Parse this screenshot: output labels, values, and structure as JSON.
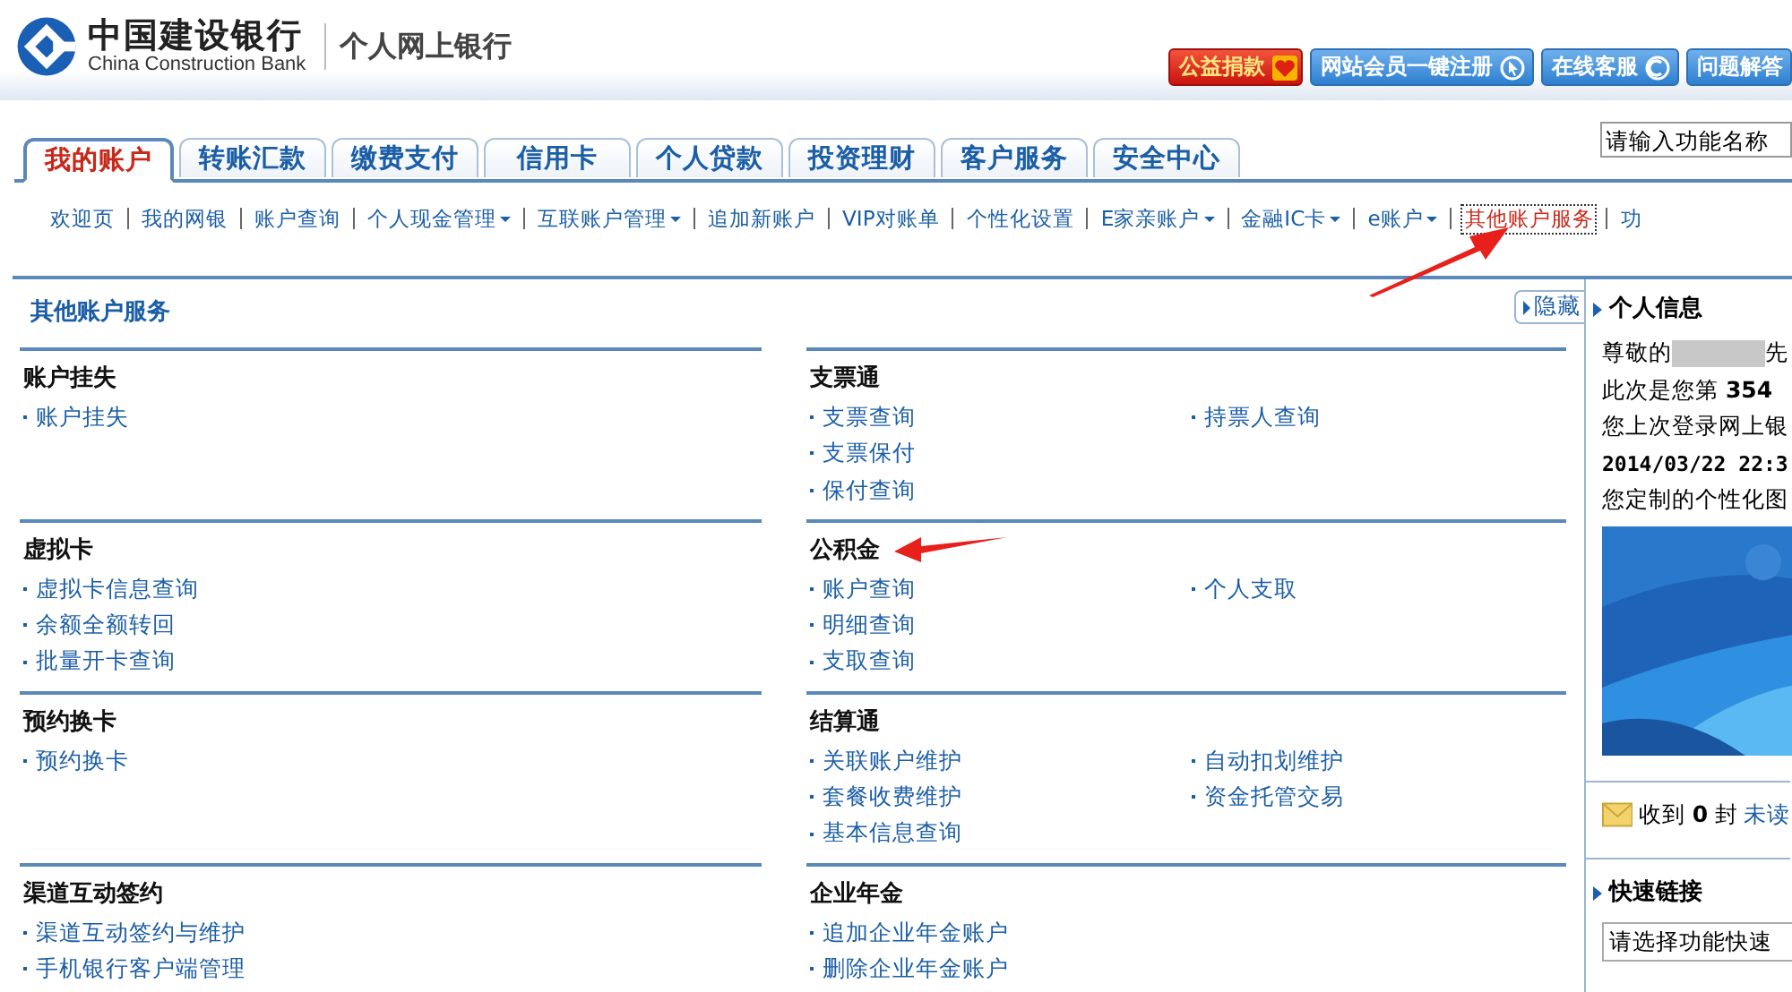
{
  "header": {
    "bank_name": "中国建设银行",
    "bank_name_en": "China Construction Bank",
    "product": "个人网上银行",
    "buttons": [
      {
        "label": "公益捐款",
        "kind": "donate"
      },
      {
        "label": "网站会员一键注册",
        "kind": "register"
      },
      {
        "label": "在线客服",
        "kind": "service"
      },
      {
        "label": "问题解答",
        "kind": "plain"
      }
    ]
  },
  "search": {
    "placeholder": "请输入功能名称"
  },
  "tabs": [
    {
      "label": "我的账户",
      "selected": true
    },
    {
      "label": "转账汇款",
      "selected": false
    },
    {
      "label": "缴费支付",
      "selected": false
    },
    {
      "label": "信用卡",
      "selected": false
    },
    {
      "label": "个人贷款",
      "selected": false
    },
    {
      "label": "投资理财",
      "selected": false
    },
    {
      "label": "客户服务",
      "selected": false
    },
    {
      "label": "安全中心",
      "selected": false
    }
  ],
  "subnav": [
    {
      "label": "欢迎页",
      "has_menu": false,
      "selected": false,
      "arrow": false
    },
    {
      "label": "我的网银",
      "has_menu": false,
      "selected": false,
      "arrow": false
    },
    {
      "label": "账户查询",
      "has_menu": false,
      "selected": false,
      "arrow": false
    },
    {
      "label": "个人现金管理",
      "has_menu": true,
      "selected": false,
      "arrow": false
    },
    {
      "label": "互联账户管理",
      "has_menu": true,
      "selected": false,
      "arrow": false
    },
    {
      "label": "追加新账户",
      "has_menu": false,
      "selected": false,
      "arrow": false
    },
    {
      "label": "VIP对账单",
      "has_menu": false,
      "selected": false,
      "arrow": false
    },
    {
      "label": "个性化设置",
      "has_menu": false,
      "selected": false,
      "arrow": false
    },
    {
      "label": "E家亲账户",
      "has_menu": true,
      "selected": false,
      "arrow": false
    },
    {
      "label": "金融IC卡",
      "has_menu": true,
      "selected": false,
      "arrow": false
    },
    {
      "label": "e账户",
      "has_menu": true,
      "selected": false,
      "arrow": false
    },
    {
      "label": "其他账户服务",
      "has_menu": false,
      "selected": true,
      "arrow": true
    },
    {
      "label": "功",
      "has_menu": false,
      "selected": false,
      "arrow": false
    }
  ],
  "page_title": "其他账户服务",
  "hide_button": "隐藏",
  "sections": [
    {
      "title": "账户挂失",
      "arrow": false,
      "columns": [
        [
          "账户挂失"
        ]
      ]
    },
    {
      "title": "支票通",
      "arrow": false,
      "columns": [
        [
          "支票查询",
          "支票保付",
          "保付查询"
        ],
        [
          "持票人查询"
        ]
      ]
    },
    {
      "title": "虚拟卡",
      "arrow": false,
      "columns": [
        [
          "虚拟卡信息查询",
          "余额全额转回",
          "批量开卡查询"
        ]
      ]
    },
    {
      "title": "公积金",
      "arrow": true,
      "columns": [
        [
          "账户查询",
          "明细查询",
          "支取查询"
        ],
        [
          "个人支取"
        ]
      ]
    },
    {
      "title": "预约换卡",
      "arrow": false,
      "columns": [
        [
          "预约换卡"
        ]
      ]
    },
    {
      "title": "结算通",
      "arrow": false,
      "columns": [
        [
          "关联账户维护",
          "套餐收费维护",
          "基本信息查询"
        ],
        [
          "自动扣划维护",
          "资金托管交易"
        ]
      ]
    },
    {
      "title": "渠道互动签约",
      "arrow": false,
      "columns": [
        [
          "渠道互动签约与维护",
          "手机银行客户端管理"
        ]
      ]
    },
    {
      "title": "企业年金",
      "arrow": false,
      "columns": [
        [
          "追加企业年金账户",
          "删除企业年金账户"
        ]
      ]
    }
  ],
  "sidebar": {
    "title": "个人信息",
    "greeting": "尊敬的",
    "greeting_suffix": "先",
    "visits": "此次是您第 **354**",
    "last_login_label": "您上次登录网上银",
    "last_login_time": "2014/03/22 22:3",
    "custom_picture": "您定制的个性化图",
    "mail": "收到 **0** 封",
    "mail_link": "未读",
    "quick_links_title": "快速链接",
    "quick_links_placeholder": "请选择功能快速"
  }
}
